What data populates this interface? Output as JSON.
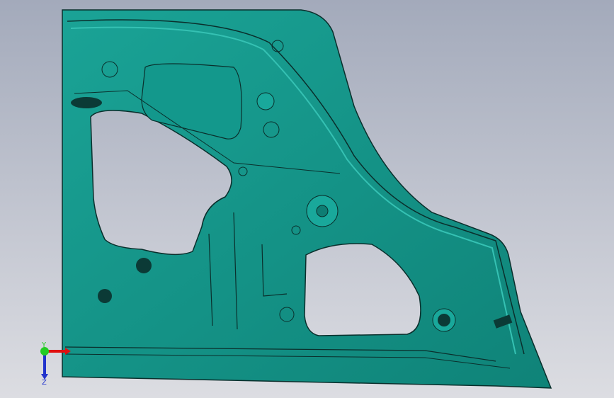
{
  "viewport": {
    "colors": {
      "part_fill": "#14958a",
      "part_edge": "#0a2f2c",
      "part_highlight": "#35c1b3",
      "background_top": "#a3aabb",
      "background_bottom": "#dcdde2"
    }
  },
  "triad": {
    "y_label": "Y",
    "z_label": "Z",
    "colors": {
      "x": "#e01010",
      "y": "#22cc22",
      "z": "#2233cc"
    }
  }
}
